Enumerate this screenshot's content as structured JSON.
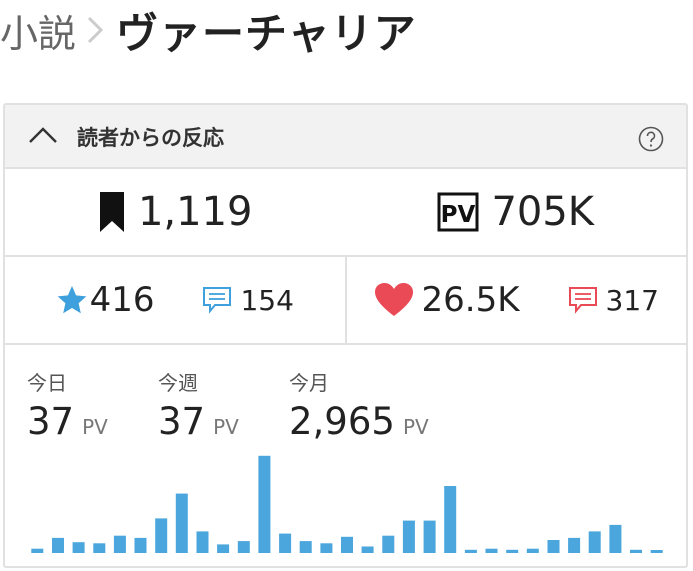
{
  "breadcrumb": {
    "parent": "小説",
    "current": "ヴァーチャリア"
  },
  "panel": {
    "title": "読者からの反応"
  },
  "stats_top": {
    "bookmarks": "1,119",
    "pv_total": "705K"
  },
  "stats_mid": {
    "stars": "416",
    "star_comments": "154",
    "likes": "26.5K",
    "like_comments": "317"
  },
  "pv": {
    "today_label": "今日",
    "today_value": "37",
    "week_label": "今週",
    "week_value": "37",
    "month_label": "今月",
    "month_value": "2,965",
    "unit": "PV"
  },
  "colors": {
    "blue": "#3ea0dc",
    "red": "#ea4956",
    "bar": "#4aa6dd"
  },
  "chart_data": {
    "type": "bar",
    "categories": [
      "1",
      "2",
      "3",
      "4",
      "5",
      "6",
      "7",
      "8",
      "9",
      "10",
      "11",
      "12",
      "13",
      "14",
      "15",
      "16",
      "17",
      "18",
      "19",
      "20",
      "21",
      "22",
      "23",
      "24",
      "25",
      "26",
      "27",
      "28",
      "29",
      "30",
      "31"
    ],
    "values": [
      4,
      14,
      10,
      9,
      16,
      14,
      32,
      55,
      20,
      8,
      11,
      90,
      18,
      11,
      9,
      15,
      6,
      16,
      30,
      30,
      62,
      3,
      4,
      3,
      4,
      12,
      14,
      20,
      26,
      3,
      0
    ],
    "ylim": [
      0,
      100
    ]
  }
}
